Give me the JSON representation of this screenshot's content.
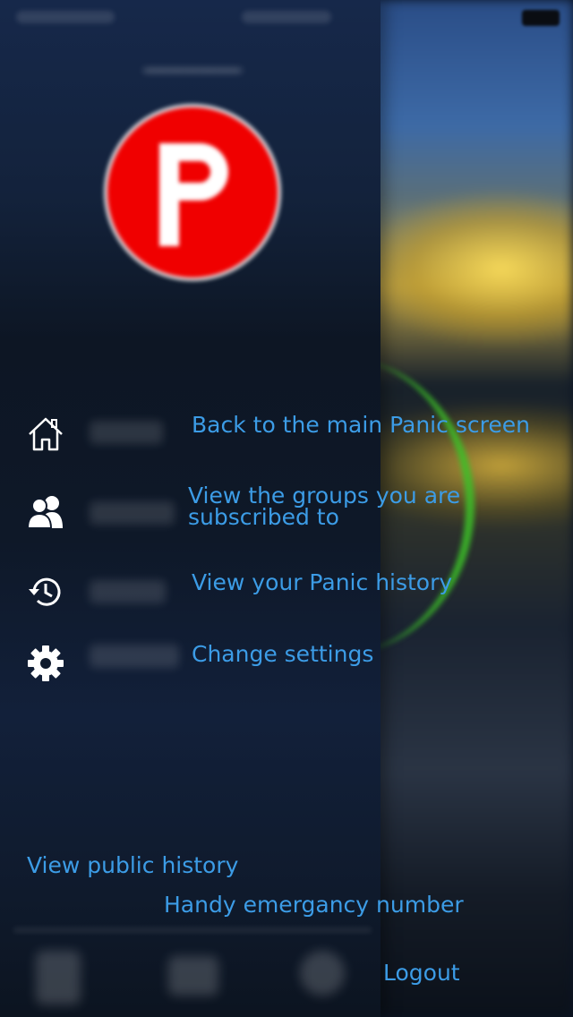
{
  "menu": [
    {
      "icon": "home-icon",
      "hint": "Back to the main Panic screen"
    },
    {
      "icon": "groups-icon",
      "hint": "View the groups you are subscribed to"
    },
    {
      "icon": "history-icon",
      "hint": "View your Panic history"
    },
    {
      "icon": "gear-icon",
      "hint": "Change settings"
    }
  ],
  "links": {
    "public_history": "View public history",
    "handy_number": "Handy emergancy number",
    "logout": "Logout"
  },
  "colors": {
    "hint_text": "#3c9ce6",
    "logo_red": "#f00000"
  }
}
